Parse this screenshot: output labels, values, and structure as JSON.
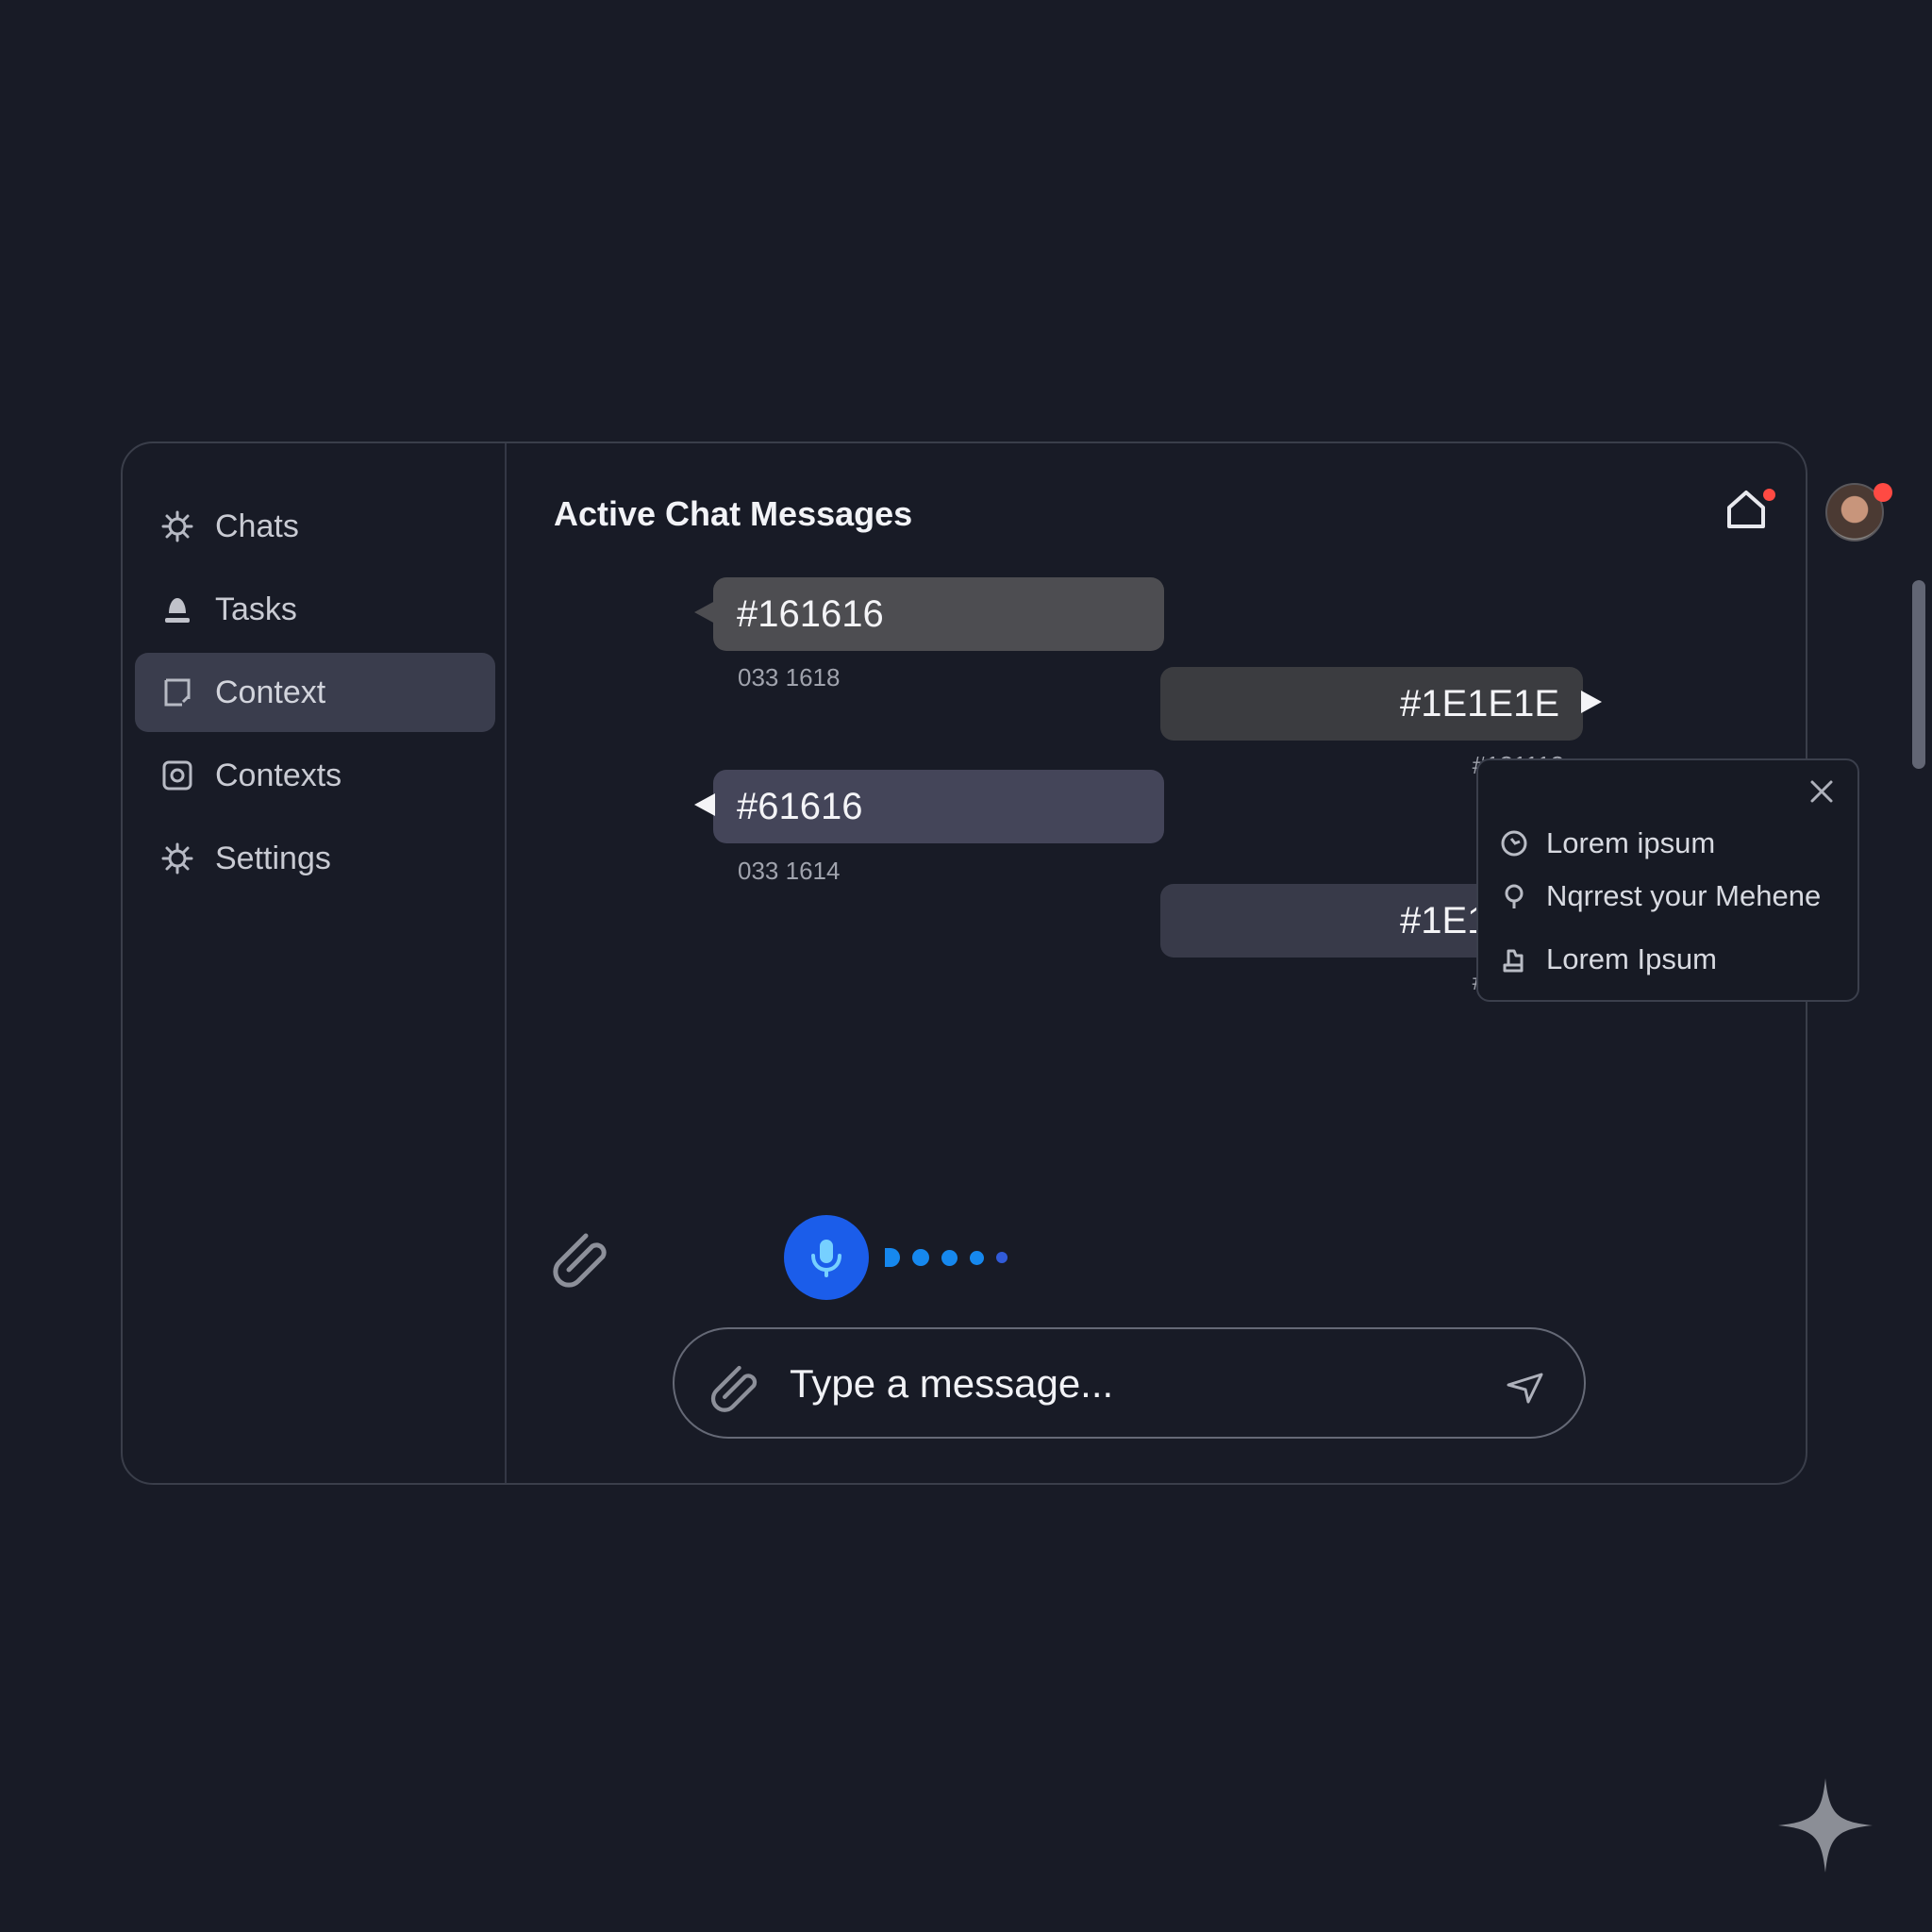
{
  "sidebar": {
    "items": [
      {
        "label": "Chats",
        "icon": "gear-icon"
      },
      {
        "label": "Tasks",
        "icon": "person-icon"
      },
      {
        "label": "Context",
        "icon": "note-icon",
        "active": true
      },
      {
        "label": "Contexts",
        "icon": "camera-icon"
      },
      {
        "label": "Settings",
        "icon": "gear-icon"
      }
    ]
  },
  "header": {
    "title": "Active Chat Messages",
    "home_icon": "home-icon",
    "notification_color": "#ff4a43"
  },
  "messages": [
    {
      "text": "#161616",
      "meta": "033 1618",
      "side": "left",
      "color": "#4d4d51"
    },
    {
      "text": "#1E1E1E",
      "meta": "#121112",
      "side": "right",
      "color": "#3b3c40"
    },
    {
      "text": "#61616",
      "meta": "033 1614",
      "side": "left",
      "color": "#444559"
    },
    {
      "text": "#1E1E1E",
      "meta": "#121112",
      "side": "right",
      "color": "#383a49"
    }
  ],
  "popup": {
    "items": [
      {
        "label": "Lorem ipsum",
        "icon": "clock-icon"
      },
      {
        "label": "Nqrrest your Mehene",
        "icon": "pin-icon"
      },
      {
        "label": "Lorem Ipsum",
        "icon": "hand-icon"
      }
    ]
  },
  "composer": {
    "placeholder": "Type a message...",
    "mic_color": "#1b5dea",
    "wave_color": "#1688ee"
  }
}
